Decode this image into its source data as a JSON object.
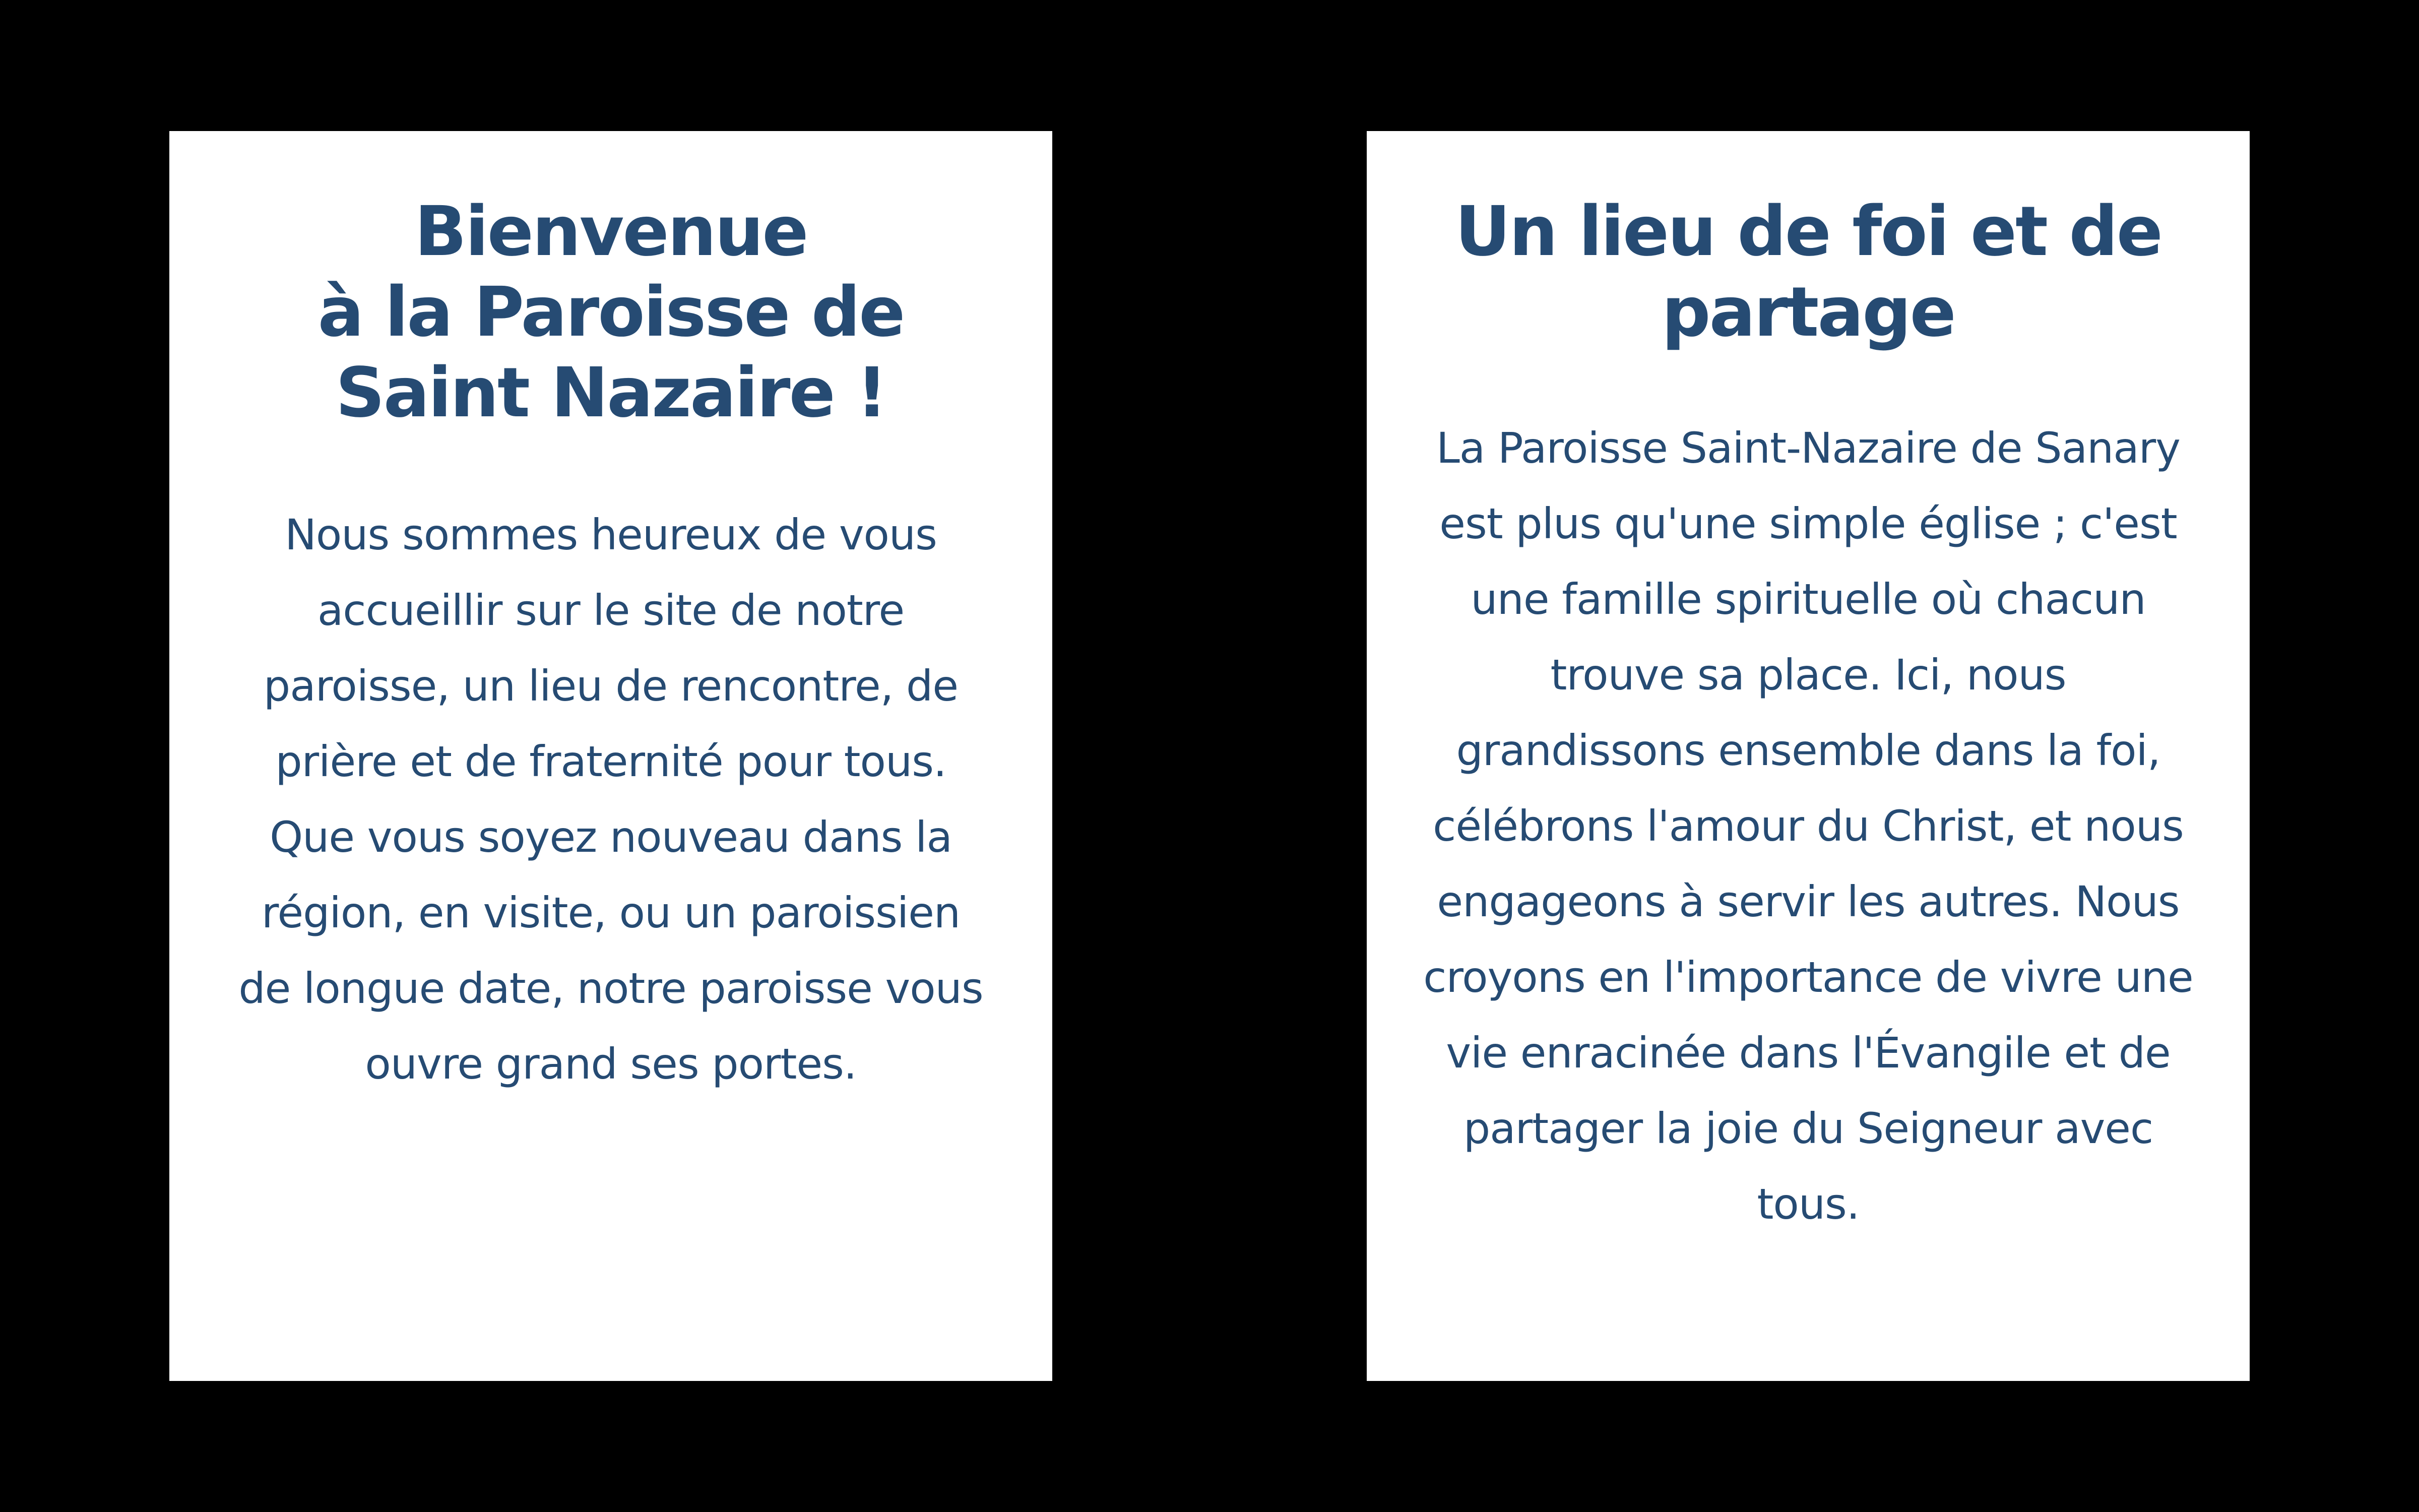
{
  "colors": {
    "background": "#000000",
    "card_background": "#ffffff",
    "text": "#254a72"
  },
  "welcome_card": {
    "title_lines": [
      "Bienvenue",
      "à la Paroisse de",
      "Saint Nazaire !"
    ],
    "body": "Nous sommes heureux de vous accueillir sur le site de notre paroisse, un lieu de rencontre, de prière et de fraternité pour tous. Que vous soyez nouveau dans la région, en visite, ou un paroissien de longue date, notre paroisse vous ouvre grand ses portes."
  },
  "faith_card": {
    "title": "Un lieu de foi et de partage",
    "body": "La Paroisse Saint-Nazaire de Sanary est plus qu'une simple église ; c'est une famille spirituelle où chacun trouve sa place. Ici, nous grandissons ensemble dans la foi, célébrons l'amour du Christ, et nous engageons à servir les autres. Nous croyons en l'importance de vivre une vie enracinée dans l'Évangile et de partager la joie du Seigneur avec tous."
  }
}
